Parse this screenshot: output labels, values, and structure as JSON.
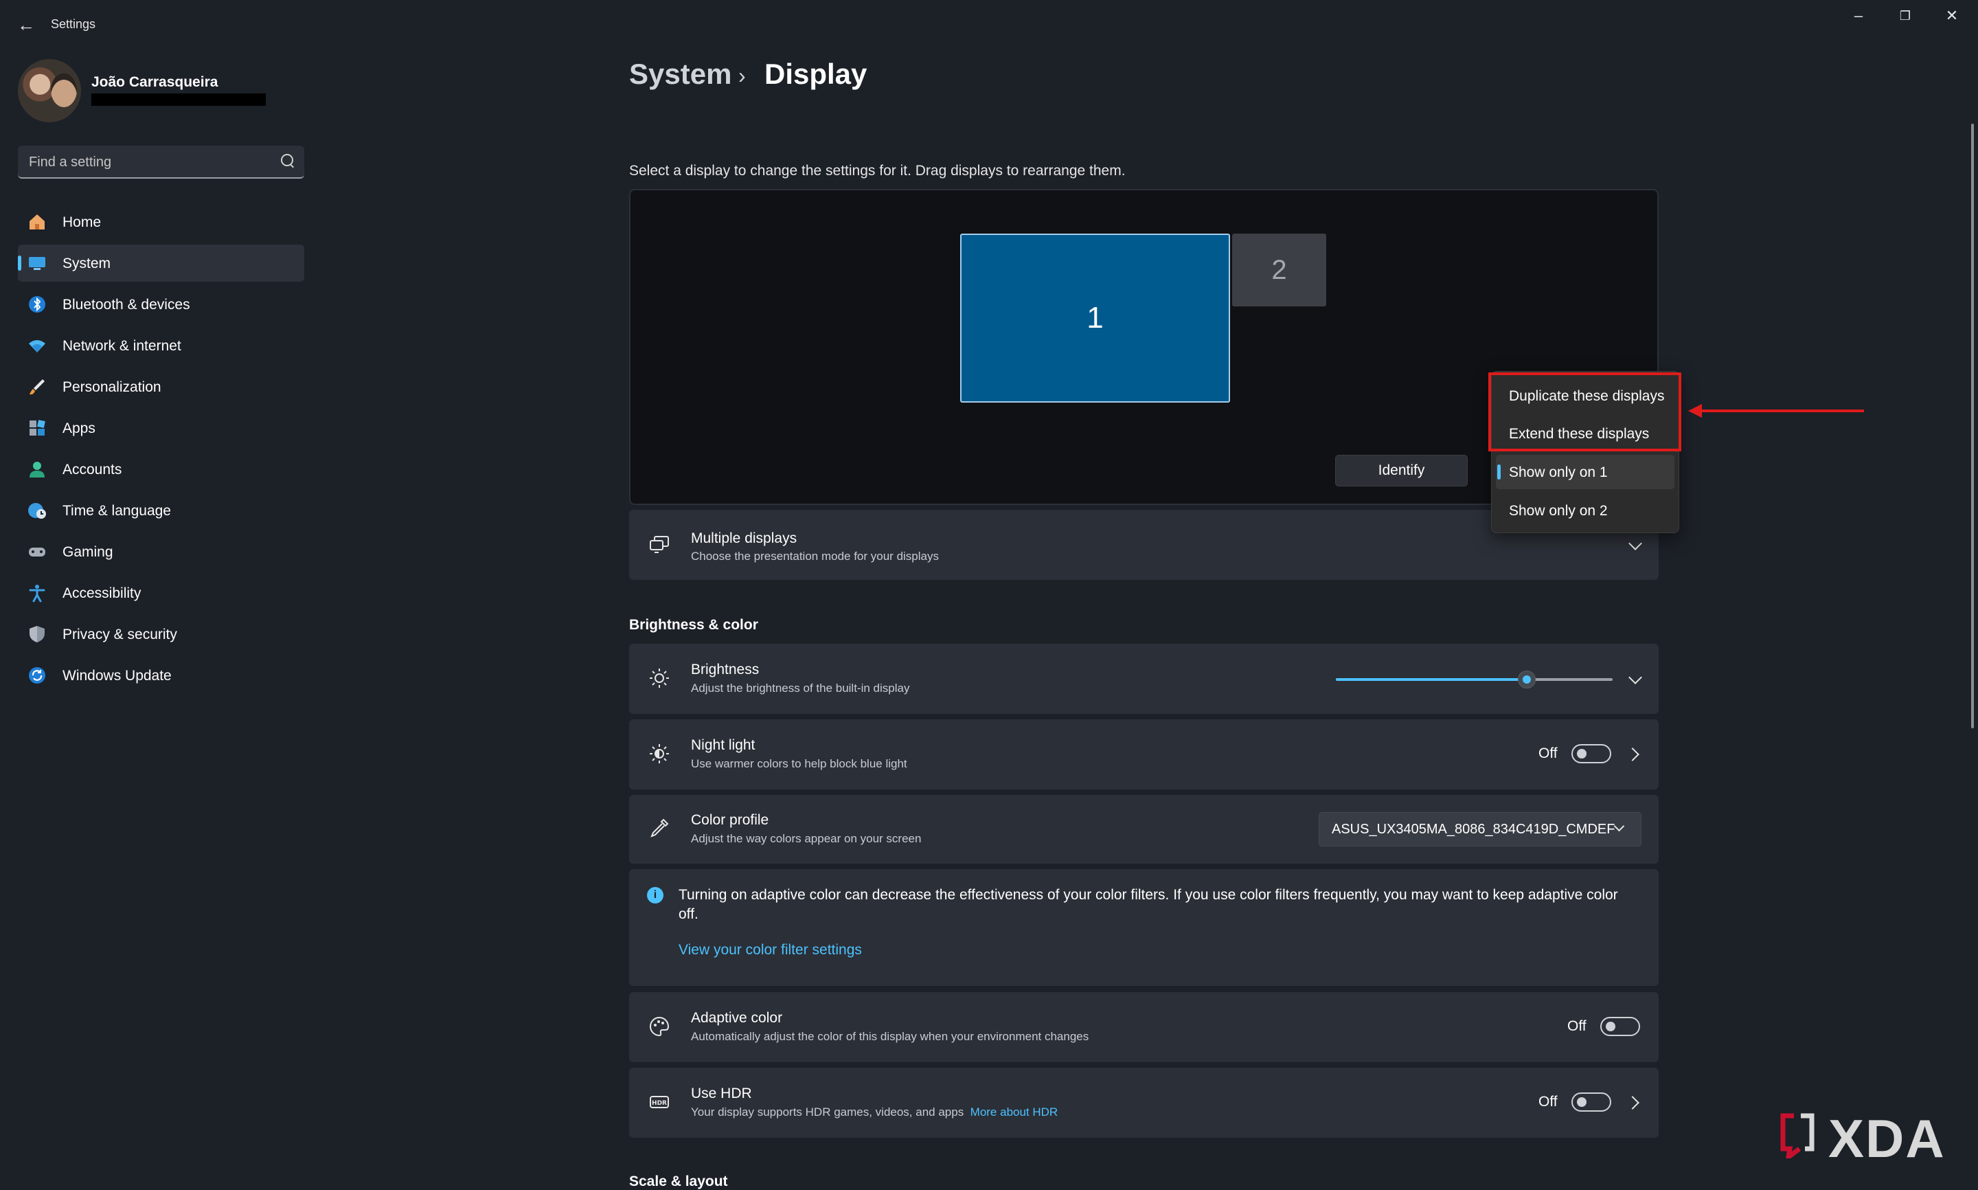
{
  "window": {
    "title": "Settings"
  },
  "user": {
    "name": "João Carrasqueira"
  },
  "search": {
    "placeholder": "Find a setting"
  },
  "nav": {
    "items": [
      {
        "label": "Home",
        "icon": "home-icon"
      },
      {
        "label": "System",
        "icon": "system-icon",
        "active": true
      },
      {
        "label": "Bluetooth & devices",
        "icon": "bluetooth-icon"
      },
      {
        "label": "Network & internet",
        "icon": "wifi-icon"
      },
      {
        "label": "Personalization",
        "icon": "brush-icon"
      },
      {
        "label": "Apps",
        "icon": "apps-icon"
      },
      {
        "label": "Accounts",
        "icon": "accounts-icon"
      },
      {
        "label": "Time & language",
        "icon": "globe-clock-icon"
      },
      {
        "label": "Gaming",
        "icon": "gamepad-icon"
      },
      {
        "label": "Accessibility",
        "icon": "accessibility-icon"
      },
      {
        "label": "Privacy & security",
        "icon": "shield-icon"
      },
      {
        "label": "Windows Update",
        "icon": "update-icon"
      }
    ]
  },
  "breadcrumb": {
    "parent": "System",
    "separator": "›",
    "current": "Display"
  },
  "display_arrangement": {
    "hint": "Select a display to change the settings for it. Drag displays to rearrange them.",
    "monitor_1": "1",
    "monitor_2": "2",
    "identify_label": "Identify"
  },
  "projection_menu": {
    "options": [
      {
        "label": "Duplicate these displays"
      },
      {
        "label": "Extend these displays"
      },
      {
        "label": "Show only on 1",
        "selected": true
      },
      {
        "label": "Show only on 2"
      }
    ]
  },
  "multiple_displays": {
    "title": "Multiple displays",
    "subtitle": "Choose the presentation mode for your displays"
  },
  "brightness_color": {
    "heading": "Brightness & color",
    "brightness": {
      "title": "Brightness",
      "subtitle": "Adjust the brightness of the built-in display",
      "value_fraction": 0.69
    },
    "night_light": {
      "title": "Night light",
      "subtitle": "Use warmer colors to help block blue light",
      "state": "Off"
    },
    "color_profile": {
      "title": "Color profile",
      "subtitle": "Adjust the way colors appear on your screen",
      "selected": "ASUS_UX3405MA_8086_834C419D_CMDEF"
    },
    "adaptive_info": {
      "text": "Turning on adaptive color can decrease the effectiveness of your color filters. If you use color filters frequently, you may want to keep adaptive color off.",
      "link": "View your color filter settings"
    },
    "adaptive_color": {
      "title": "Adaptive color",
      "subtitle": "Automatically adjust the color of this display when your environment changes",
      "state": "Off"
    },
    "hdr": {
      "title": "Use HDR",
      "subtitle": "Your display supports HDR games, videos, and apps",
      "link": "More about HDR",
      "state": "Off"
    }
  },
  "scale_layout": {
    "heading": "Scale & layout"
  },
  "watermark": {
    "text": "XDA"
  },
  "colors": {
    "accent": "#4cc2ff",
    "highlight": "#e01b1b",
    "monitor_selected": "#005a8e"
  }
}
